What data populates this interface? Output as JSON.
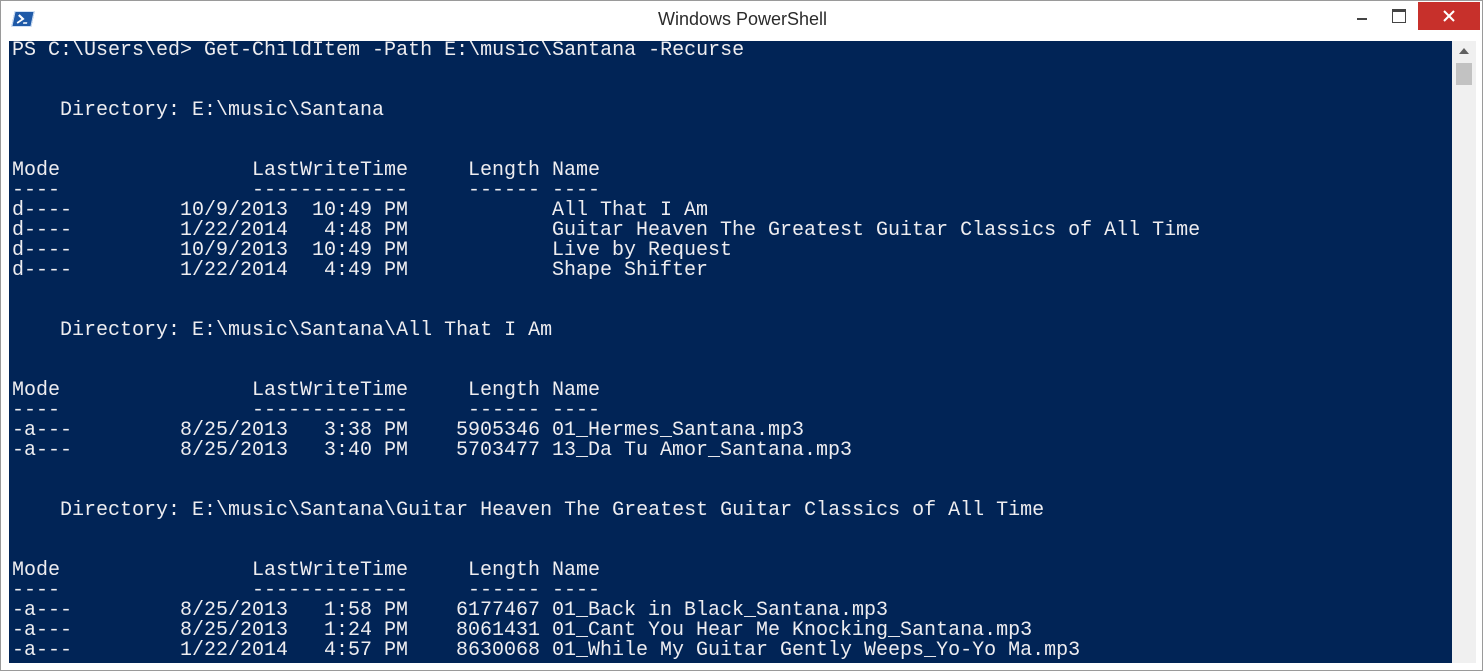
{
  "window": {
    "title": "Windows PowerShell"
  },
  "console": {
    "prompt_line": "PS C:\\Users\\ed> Get-ChildItem -Path E:\\music\\Santana -Recurse",
    "headers": {
      "mode": "Mode",
      "lastwritetime": "LastWriteTime",
      "length": "Length",
      "name": "Name",
      "mode_rule": "----",
      "lastwritetime_rule": "-------------",
      "length_rule": "------",
      "name_rule": "----"
    },
    "directories": [
      {
        "label": "    Directory: E:\\music\\Santana",
        "rows": [
          {
            "mode": "d----",
            "date": "10/9/2013",
            "time": "10:49 PM",
            "length": "",
            "name": "All That I Am"
          },
          {
            "mode": "d----",
            "date": "1/22/2014",
            "time": "4:48 PM",
            "length": "",
            "name": "Guitar Heaven The Greatest Guitar Classics of All Time"
          },
          {
            "mode": "d----",
            "date": "10/9/2013",
            "time": "10:49 PM",
            "length": "",
            "name": "Live by Request"
          },
          {
            "mode": "d----",
            "date": "1/22/2014",
            "time": "4:49 PM",
            "length": "",
            "name": "Shape Shifter"
          }
        ]
      },
      {
        "label": "    Directory: E:\\music\\Santana\\All That I Am",
        "rows": [
          {
            "mode": "-a---",
            "date": "8/25/2013",
            "time": "3:38 PM",
            "length": "5905346",
            "name": "01_Hermes_Santana.mp3"
          },
          {
            "mode": "-a---",
            "date": "8/25/2013",
            "time": "3:40 PM",
            "length": "5703477",
            "name": "13_Da Tu Amor_Santana.mp3"
          }
        ]
      },
      {
        "label": "    Directory: E:\\music\\Santana\\Guitar Heaven The Greatest Guitar Classics of All Time",
        "rows": [
          {
            "mode": "-a---",
            "date": "8/25/2013",
            "time": "1:58 PM",
            "length": "6177467",
            "name": "01_Back in Black_Santana.mp3"
          },
          {
            "mode": "-a---",
            "date": "8/25/2013",
            "time": "1:24 PM",
            "length": "8061431",
            "name": "01_Cant You Hear Me Knocking_Santana.mp3"
          },
          {
            "mode": "-a---",
            "date": "1/22/2014",
            "time": "4:57 PM",
            "length": "8630068",
            "name": "01_While My Guitar Gently Weeps_Yo-Yo Ma.mp3"
          }
        ]
      }
    ]
  },
  "colors": {
    "console_background": "#012456",
    "console_text": "#eeedf0",
    "close_button": "#c7302b"
  },
  "icons": {
    "app": "powershell-icon",
    "minimize": "minimize-icon",
    "maximize": "maximize-icon",
    "close": "close-icon",
    "scroll_up": "scroll-up-arrow-icon"
  }
}
